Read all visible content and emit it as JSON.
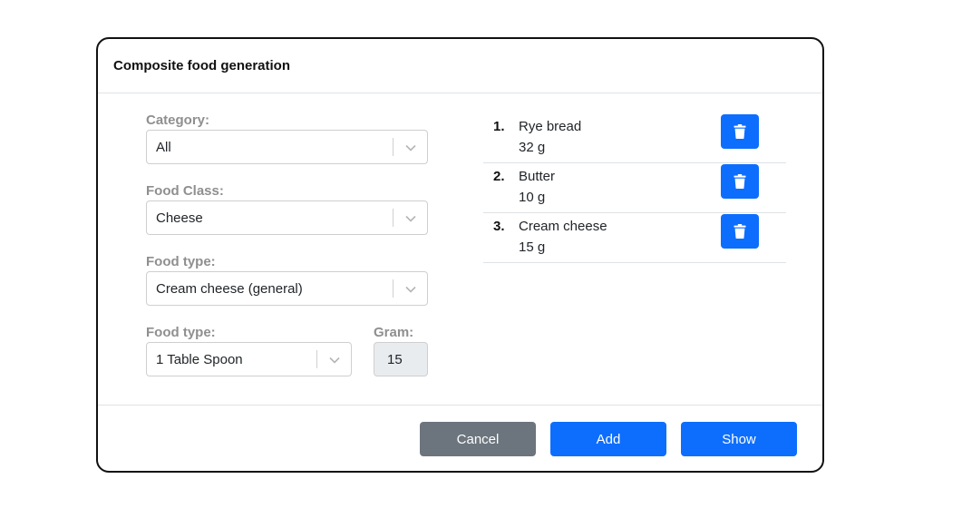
{
  "modal": {
    "title": "Composite food generation"
  },
  "form": {
    "category": {
      "label": "Category:",
      "value": "All"
    },
    "food_class": {
      "label": "Food Class:",
      "value": "Cheese"
    },
    "food_type": {
      "label": "Food type:",
      "value": "Cream cheese (general)"
    },
    "portion": {
      "label": "Food type:",
      "value": "1 Table Spoon"
    },
    "gram": {
      "label": "Gram:",
      "value": "15"
    }
  },
  "items": [
    {
      "num": "1.",
      "name": "Rye bread",
      "gram": "32 g"
    },
    {
      "num": "2.",
      "name": "Butter",
      "gram": "10 g"
    },
    {
      "num": "3.",
      "name": "Cream cheese",
      "gram": "15 g"
    }
  ],
  "footer": {
    "cancel_label": "Cancel",
    "add_label": "Add",
    "show_label": "Show"
  },
  "colors": {
    "primary": "#0d6efd",
    "secondary": "#6c757d",
    "label_gray": "#8f8f8f",
    "readonly_bg": "#e9ecef"
  },
  "icons": {
    "delete": "trash-icon",
    "dropdown": "chevron-down-icon"
  }
}
